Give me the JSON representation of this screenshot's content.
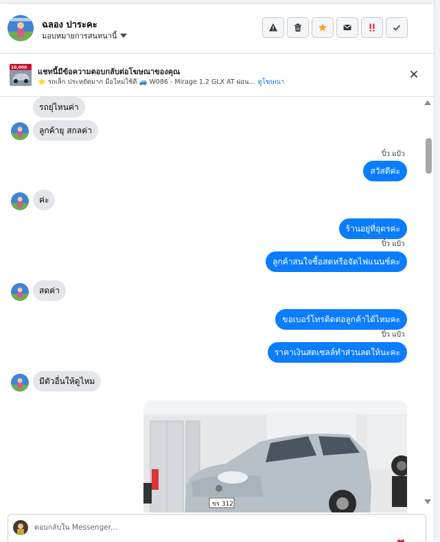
{
  "header": {
    "contact_name": "ฉลอง ปาระคะ",
    "assign_label": "มอบหมายการสนทนานี้",
    "actions": [
      {
        "name": "spam-warning",
        "icon": "warning-triangle-icon"
      },
      {
        "name": "delete",
        "icon": "trash-icon"
      },
      {
        "name": "star",
        "icon": "star-icon",
        "color": "#f5a623"
      },
      {
        "name": "mark-unread",
        "icon": "envelope-icon"
      },
      {
        "name": "follow-up",
        "icon": "exclamation-icon",
        "color": "#e41e3f"
      },
      {
        "name": "mark-done",
        "icon": "check-icon"
      }
    ]
  },
  "ad": {
    "title": "แชทนี้มีข้อความตอบกลับต่อโฆษณาของคุณ",
    "subtitle": "⭐ รถเล็ก ประหยัดมาก มือใหม่ใช้ดี 🚙 W086 - Mirage 1.2 GLX AT ผ่อน...",
    "link": "ดูโฆษณา",
    "thumb_badge": "10,000"
  },
  "messages": [
    {
      "dir": "in",
      "text": "รถยุ่ไหนค่า",
      "avatar": false
    },
    {
      "dir": "in",
      "text": "ลูกค้ายุ สกลค่า",
      "avatar": true
    },
    {
      "dir": "seen",
      "text": "ปิ๋ว แป้ว"
    },
    {
      "dir": "out",
      "text": "สวัสดีค่ะ"
    },
    {
      "dir": "in",
      "text": "ค่ะ",
      "avatar": true
    },
    {
      "dir": "out",
      "text": "ร้านอยู่ที่อุดรค่ะ"
    },
    {
      "dir": "seen",
      "text": "ปิ๋ว แป้ว"
    },
    {
      "dir": "out",
      "text": "ลูกค้าสนใจซื้อสดหรือจัดไฟแนนซ์คะ"
    },
    {
      "dir": "in",
      "text": "สดค่า",
      "avatar": true
    },
    {
      "dir": "out",
      "text": "ขอเบอร์โทรติดต่อลูกค้าได้ไหมคะ"
    },
    {
      "dir": "seen",
      "text": "ปิ๋ว แป้ว"
    },
    {
      "dir": "out",
      "text": "ราคาเงินสดเซลล์ทำส่วนลดให้นะคะ"
    },
    {
      "dir": "in",
      "text": "มีตัวอื่นให้ดูไหม",
      "avatar": true
    },
    {
      "dir": "image",
      "plate_text": "ขร 312"
    }
  ],
  "composer": {
    "placeholder": "ตอบกลับใน Messenger..."
  },
  "colors": {
    "outgoing": "#0a7cff",
    "incoming": "#e4e6eb",
    "link": "#1b74e4"
  }
}
